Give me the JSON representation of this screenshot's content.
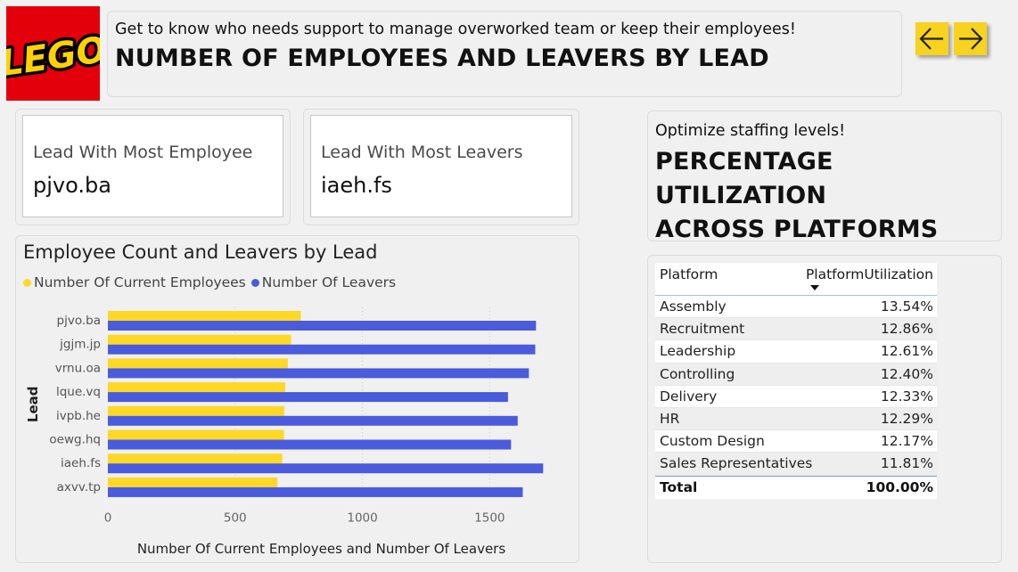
{
  "header": {
    "subtitle": "Get to know who needs support to manage overworked team or keep their employees!",
    "title": "NUMBER OF EMPLOYEES AND LEAVERS BY LEAD"
  },
  "logo": {
    "text": "LEGO"
  },
  "nav": {
    "back_icon": "arrow-left-icon",
    "forward_icon": "arrow-right-icon",
    "color": "#f7d21e"
  },
  "kpis": {
    "most_employee": {
      "label": "Lead With Most Employee",
      "value": "pjvo.ba"
    },
    "most_leavers": {
      "label": "Lead With Most Leavers",
      "value": "iaeh.fs"
    }
  },
  "chart_data": {
    "type": "bar",
    "orientation": "horizontal",
    "title": "Employee Count and Leavers by Lead",
    "xlabel": "Number Of Current Employees and Number Of Leavers",
    "ylabel": "Lead",
    "categories": [
      "pjvo.ba",
      "jgjm.jp",
      "vrnu.oa",
      "lque.vq",
      "ivpb.he",
      "oewg.hq",
      "iaeh.fs",
      "axvv.tp"
    ],
    "series": [
      {
        "name": "Number Of Current Employees",
        "color": "#fdd826",
        "values": [
          758,
          720,
          707,
          697,
          693,
          692,
          685,
          666
        ]
      },
      {
        "name": "Number Of Leavers",
        "color": "#4a5bdc",
        "values": [
          1682,
          1679,
          1654,
          1572,
          1610,
          1584,
          1710,
          1630
        ]
      }
    ],
    "xlim": [
      0,
      1800
    ],
    "xticks": [
      0,
      500,
      1000,
      1500
    ],
    "grid": true,
    "legend": "top-left"
  },
  "utilization": {
    "subtitle": "Optimize staffing levels!",
    "title_lines": [
      "PERCENTAGE UTILIZATION",
      "ACROSS PLATFORMS"
    ],
    "table": {
      "headers": [
        "Platform",
        "PlatformUtilization"
      ],
      "rows": [
        {
          "platform": "Assembly",
          "value": "13.54%"
        },
        {
          "platform": "Recruitment",
          "value": "12.86%"
        },
        {
          "platform": "Leadership",
          "value": "12.61%"
        },
        {
          "platform": "Controlling",
          "value": "12.40%"
        },
        {
          "platform": "Delivery",
          "value": "12.33%"
        },
        {
          "platform": "HR",
          "value": "12.29%"
        },
        {
          "platform": "Custom Design",
          "value": "12.17%"
        },
        {
          "platform": "Sales Representatives",
          "value": "11.81%"
        }
      ],
      "total": {
        "label": "Total",
        "value": "100.00%"
      }
    }
  }
}
